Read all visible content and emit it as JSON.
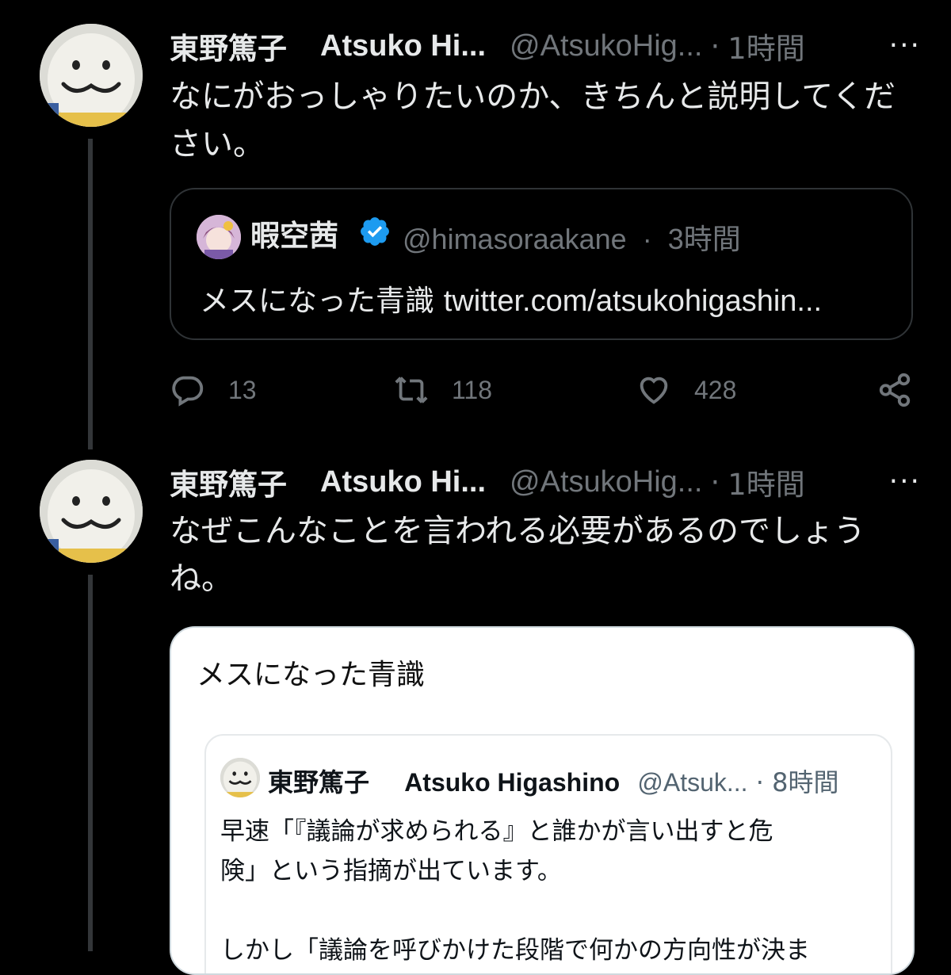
{
  "tweet1": {
    "display_name": "東野篤子",
    "alt_name": "Atsuko Hi...",
    "handle": "@AtsukoHig...",
    "time": "1時間",
    "more": "···",
    "text": "なにがおっしゃりたいのか、きちんと説明してくだ\nさい。",
    "quote": {
      "name": "暇空茜",
      "handle": "@himasoraakane",
      "time": "3時間",
      "text_prefix": "メスになった青識 ",
      "link": "twitter.com/atsukohigashin..."
    },
    "actions": {
      "replies": "13",
      "retweets": "118",
      "likes": "428"
    }
  },
  "tweet2": {
    "display_name": "東野篤子",
    "alt_name": "Atsuko Hi...",
    "handle": "@AtsukoHig...",
    "time": "1時間",
    "more": "···",
    "text": "なぜこんなことを言われる必要があるのでしょう\nね。",
    "image": {
      "title": "メスになった青識",
      "inner": {
        "name": "東野篤子",
        "alt_name": "Atsuko Higashino",
        "handle": "@Atsuk...",
        "time": "8時間",
        "text": "早速「『議論が求められる』と誰かが言い出すと危\n険」という指摘が出ています。\n\nしかし「議論を呼びかけた段階で何かの方向性が決ま"
      }
    }
  },
  "colors": {
    "background": "#000000",
    "text": "#e7e9ea",
    "muted": "#71767b",
    "verified": "#1d9bf0"
  },
  "icons": [
    "reply-icon",
    "retweet-icon",
    "like-icon",
    "share-icon",
    "verified-badge-icon",
    "more-icon"
  ]
}
